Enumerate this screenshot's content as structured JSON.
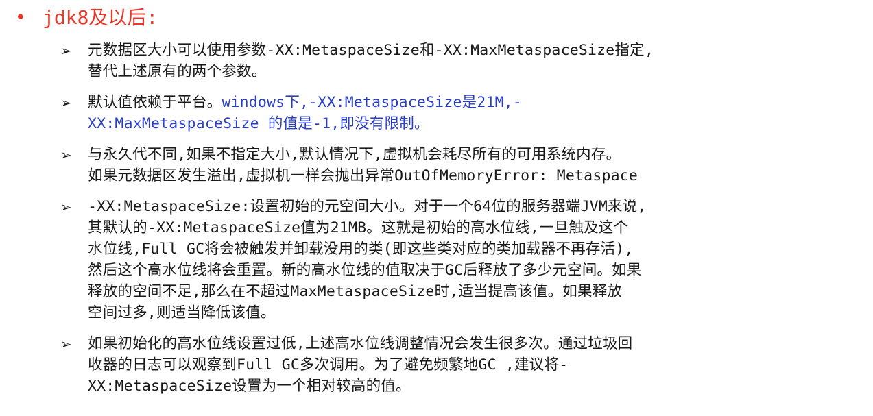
{
  "heading": {
    "bullet": "•",
    "text": "jdk8及以后:"
  },
  "items": [
    {
      "lines": [
        [
          {
            "text": "元数据区大小可以使用参数-XX:MetaspaceSize和-XX:MaxMetaspaceSize指定,",
            "color": "default"
          }
        ],
        [
          {
            "text": "替代上述原有的两个参数。",
            "color": "default"
          }
        ]
      ]
    },
    {
      "lines": [
        [
          {
            "text": "默认值依赖于平台。",
            "color": "default"
          },
          {
            "text": "windows下,-XX:MetaspaceSize是21M,-",
            "color": "blue"
          }
        ],
        [
          {
            "text": "XX:MaxMetaspaceSize 的值是-1,即没有限制。",
            "color": "blue"
          }
        ]
      ]
    },
    {
      "lines": [
        [
          {
            "text": "与永久代不同,如果不指定大小,默认情况下,虚拟机会耗尽所有的可用系统内存。",
            "color": "default"
          }
        ],
        [
          {
            "text": "如果元数据区发生溢出,虚拟机一样会抛出异常OutOfMemoryError: Metaspace",
            "color": "default"
          }
        ]
      ]
    },
    {
      "lines": [
        [
          {
            "text": "-XX:MetaspaceSize:设置初始的元空间大小。对于一个64位的服务器端JVM来说,",
            "color": "default"
          }
        ],
        [
          {
            "text": "其默认的-XX:MetaspaceSize值为21MB。这就是初始的高水位线,一旦触及这个",
            "color": "default"
          }
        ],
        [
          {
            "text": "水位线,Full GC将会被触发并卸载没用的类(即这些类对应的类加载器不再存活),",
            "color": "default"
          }
        ],
        [
          {
            "text": "然后这个高水位线将会重置。新的高水位线的值取决于GC后释放了多少元空间。如果",
            "color": "default"
          }
        ],
        [
          {
            "text": "释放的空间不足,那么在不超过MaxMetaspaceSize时,适当提高该值。如果释放",
            "color": "default"
          }
        ],
        [
          {
            "text": "空间过多,则适当降低该值。",
            "color": "default"
          }
        ]
      ]
    },
    {
      "lines": [
        [
          {
            "text": "如果初始化的高水位线设置过低,上述高水位线调整情况会发生很多次。通过垃圾回",
            "color": "default"
          }
        ],
        [
          {
            "text": "收器的日志可以观察到Full GC多次调用。为了避免频繁地GC ,建议将-",
            "color": "default"
          }
        ],
        [
          {
            "text": "XX:MetaspaceSize设置为一个相对较高的值。",
            "color": "default"
          }
        ]
      ]
    }
  ],
  "colors": {
    "heading": "#e8392b",
    "text": "#1a1a1a",
    "highlight": "#2a3fc7"
  },
  "icons": {
    "heading_bullet": "bullet-dot-icon",
    "item_bullet": "arrow-bullet-icon"
  },
  "arrow_glyph": "➢"
}
